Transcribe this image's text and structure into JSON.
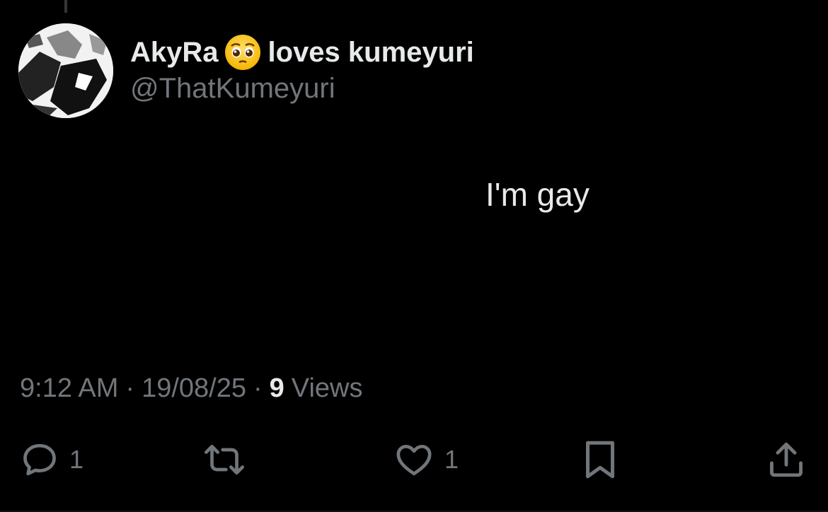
{
  "author": {
    "name": "AkyRa",
    "name_suffix": "loves kumeyuri",
    "emoji": "pleading-face-emoji",
    "handle": "@ThatKumeyuri"
  },
  "tweet": {
    "text": "I'm gay"
  },
  "meta": {
    "time": "9:12 AM",
    "separator": "·",
    "date": "19/08/25",
    "views_count": "9",
    "views_label": "Views"
  },
  "actions": {
    "reply_count": "1",
    "like_count": "1"
  },
  "colors": {
    "background": "#000000",
    "primary_text": "#e7e9ea",
    "secondary_text": "#71767b"
  }
}
